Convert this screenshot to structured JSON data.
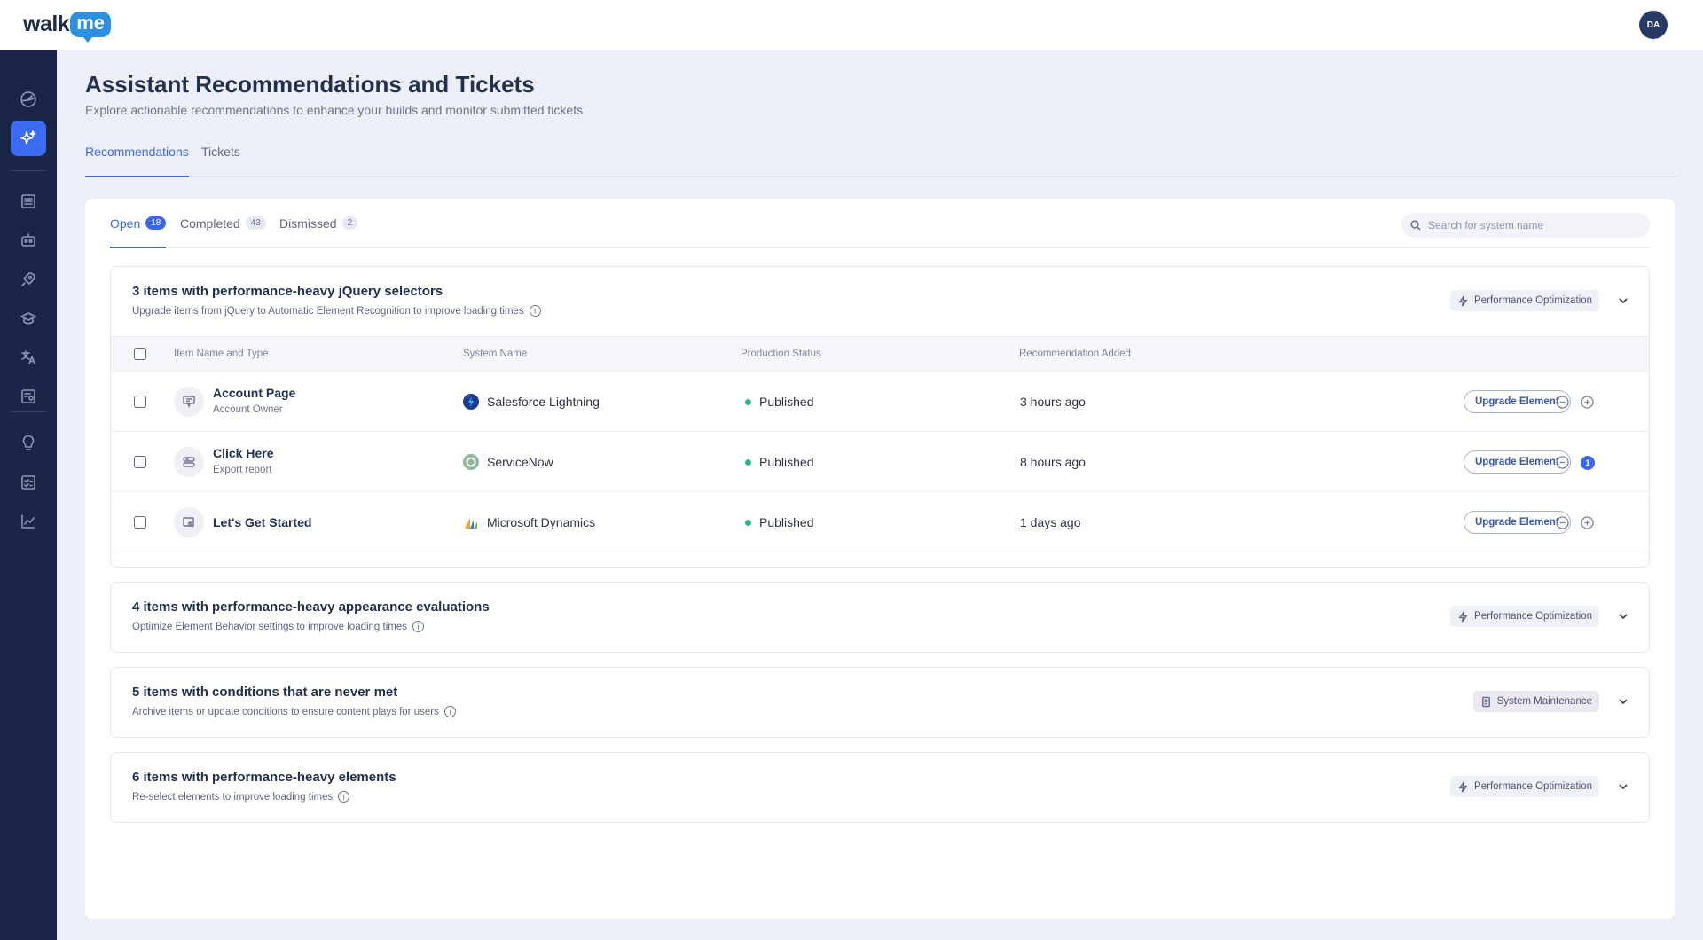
{
  "app": {
    "logo_walk": "walk",
    "logo_me": "me",
    "avatar_initials": "DA"
  },
  "sidebar": {
    "items": [
      {
        "icon": "dashboard-icon"
      },
      {
        "icon": "ai-sparkle-icon",
        "active": true
      },
      {
        "icon": "content-list-icon"
      },
      {
        "icon": "bot-icon"
      },
      {
        "icon": "rocket-icon"
      },
      {
        "icon": "graduation-cap-icon"
      },
      {
        "icon": "translate-icon"
      },
      {
        "icon": "settings-share-icon"
      },
      {
        "icon": "lightbulb-icon"
      },
      {
        "icon": "checklist-icon"
      },
      {
        "icon": "analytics-icon"
      }
    ]
  },
  "header": {
    "title": "Assistant Recommendations and Tickets",
    "subtitle": "Explore actionable recommendations to enhance your builds and monitor submitted tickets"
  },
  "main_tabs": [
    {
      "label": "Recommendations",
      "active": true
    },
    {
      "label": "Tickets",
      "active": false
    }
  ],
  "sub_tabs": [
    {
      "label": "Open",
      "count": "18",
      "active": true
    },
    {
      "label": "Completed",
      "count": "43"
    },
    {
      "label": "Dismissed",
      "count": "2"
    }
  ],
  "search": {
    "placeholder": "Search for system name"
  },
  "table_headers": {
    "item": "Item Name and Type",
    "system": "System Name",
    "status": "Production Status",
    "added": "Recommendation Added"
  },
  "groups": [
    {
      "title": "3 items with performance-heavy jQuery selectors",
      "description": "Upgrade items from jQuery to Automatic Element Recognition to improve loading times",
      "tag": "Performance Optimization",
      "expanded": true,
      "rows": [
        {
          "name": "Account Page",
          "type": "Account Owner",
          "system": "Salesforce Lightning",
          "status": "Published",
          "added": "3 hours ago",
          "action": "Upgrade Element"
        },
        {
          "name": "Click Here",
          "type": "Export report",
          "system": "ServiceNow",
          "status": "Published",
          "added": "8 hours ago",
          "action": "Upgrade Element",
          "notification_count": "1"
        },
        {
          "name": "Let's Get Started",
          "type": "",
          "system": "Microsoft Dynamics",
          "status": "Published",
          "added": "1 days ago",
          "action": "Upgrade Element"
        }
      ]
    },
    {
      "title": "4 items with performance-heavy appearance evaluations",
      "description": "Optimize Element Behavior settings to improve loading times",
      "tag": "Performance Optimization"
    },
    {
      "title": "5 items with conditions that are never met",
      "description": "Archive items or update conditions to ensure content plays for users",
      "tag": "System Maintenance"
    },
    {
      "title": "6 items with performance-heavy elements",
      "description": "Re-select elements to improve loading times",
      "tag": "Performance Optimization"
    }
  ],
  "colors": {
    "sidebar_bg": "#1b2547",
    "accent": "#3b68e6",
    "published": "#2bb58c",
    "page_bg": "#eceff7"
  }
}
